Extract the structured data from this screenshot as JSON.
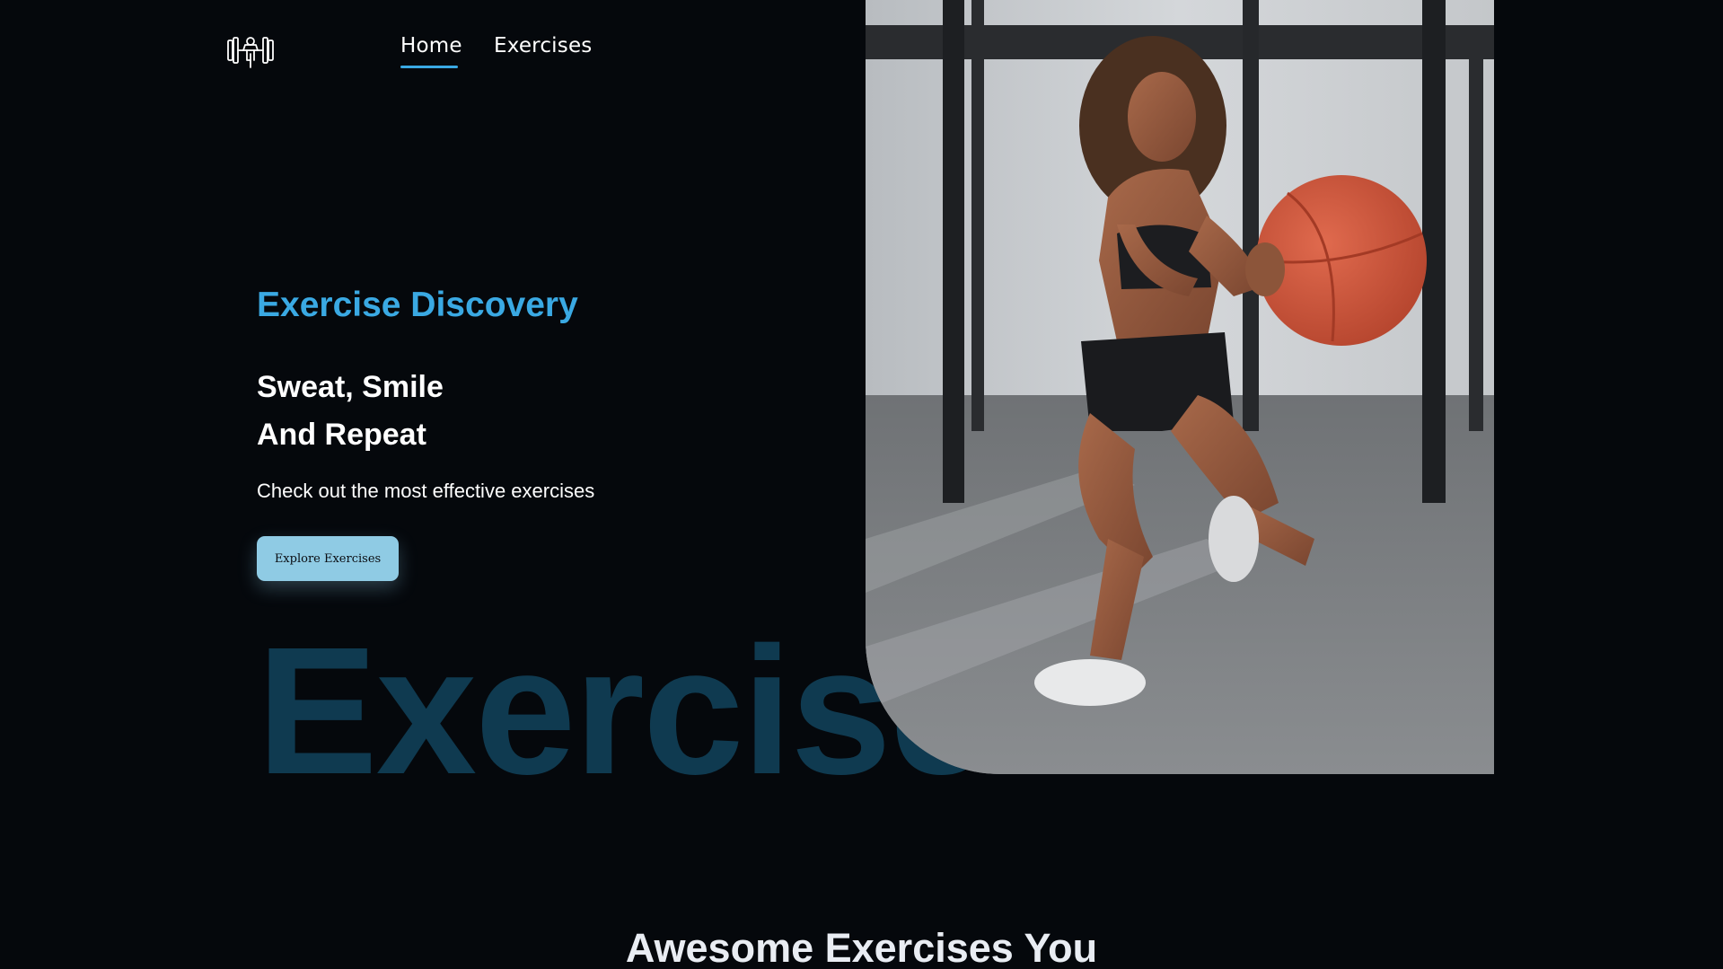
{
  "nav": {
    "logo_icon": "weightlifter-icon",
    "links": [
      {
        "label": "Home",
        "active": true
      },
      {
        "label": "Exercises",
        "active": false
      }
    ]
  },
  "hero": {
    "eyebrow": "Exercise Discovery",
    "title_line1": "Sweat, Smile",
    "title_line2": "And Repeat",
    "subtitle": "Check out the most effective exercises",
    "cta_label": "Explore Exercises",
    "watermark": "Exercise"
  },
  "section": {
    "heading": "Awesome Exercises You"
  },
  "colors": {
    "background": "#05080c",
    "accent": "#3aa9e3",
    "button": "#8fcbe4",
    "watermark": "#0f3a50"
  }
}
